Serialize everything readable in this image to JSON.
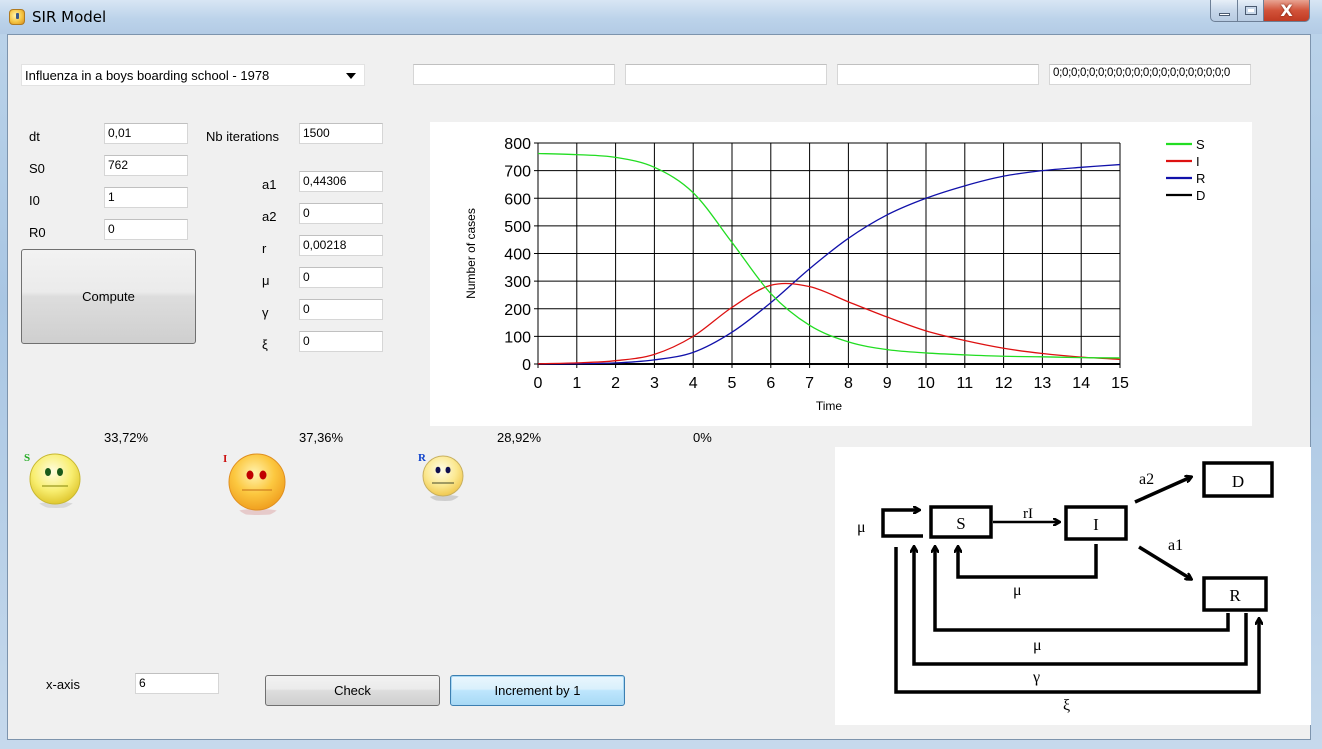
{
  "window": {
    "title": "SIR Model",
    "app_icon": "sir-app-icon",
    "controls": {
      "minimize": "minimize-icon",
      "maximize": "maximize-icon",
      "close": "close-icon"
    },
    "close_glyph": "X"
  },
  "top_row": {
    "scenario_select": {
      "value": "Influenza in a boys boarding school - 1978",
      "icon": "chevron-down-icon"
    },
    "text_boxes": [
      "",
      "",
      "",
      "0;0;0;0;0;0;0;0;0;0;0;0;0;0;0;0;0;0;0;0"
    ]
  },
  "params_left": [
    {
      "label": "dt",
      "value": "0,01"
    },
    {
      "label": "S0",
      "value": "762"
    },
    {
      "label": "I0",
      "value": "1"
    },
    {
      "label": "R0",
      "value": "0"
    }
  ],
  "iterations": {
    "label": "Nb iterations",
    "value": "1500"
  },
  "params_right": [
    {
      "label": "a1",
      "value": "0,44306"
    },
    {
      "label": "a2",
      "value": "0"
    },
    {
      "label": "r",
      "value": "0,00218"
    },
    {
      "label": "μ",
      "value": "0"
    },
    {
      "label": "γ",
      "value": "0"
    },
    {
      "label": "ξ",
      "value": "0"
    }
  ],
  "compute_button": "Compute",
  "percentages": {
    "S": "33,72%",
    "I": "37,36%",
    "R": "28,92%",
    "D": "0%"
  },
  "smileys": [
    {
      "letter": "S",
      "icon": "neutral-smiley-icon",
      "letter_color": "#22aa22",
      "eye_color": "#1a5a1a"
    },
    {
      "letter": "I",
      "icon": "neutral-smiley-icon",
      "letter_color": "#cc1111",
      "eye_color": "#c00000"
    },
    {
      "letter": "R",
      "icon": "neutral-smiley-icon",
      "letter_color": "#1144cc",
      "eye_color": "#101050"
    }
  ],
  "x_axis": {
    "label": "x-axis",
    "value": "6"
  },
  "check_button": "Check",
  "increment_button": "Increment by 1",
  "diagram": {
    "nodes": [
      "S",
      "I",
      "D",
      "R"
    ],
    "edge_labels": {
      "birth": "μ",
      "infection": "rI",
      "death": "a2",
      "recovery": "a1",
      "i_to_s": "μ",
      "r_to_s": "μ",
      "gamma": "γ",
      "xi": "ξ"
    }
  },
  "chart_data": {
    "type": "line",
    "title": "",
    "xlabel": "Time",
    "ylabel": "Number of cases",
    "xlim": [
      0,
      15
    ],
    "ylim": [
      0,
      800
    ],
    "x_ticks": [
      "0",
      "1",
      "2",
      "3",
      "4",
      "5",
      "6",
      "7",
      "8",
      "9",
      "10",
      "11",
      "12",
      "13",
      "14",
      "15"
    ],
    "y_ticks": [
      "0",
      "100",
      "200",
      "300",
      "400",
      "500",
      "600",
      "700",
      "800"
    ],
    "grid": true,
    "legend": "top-right",
    "x": [
      0,
      1,
      2,
      3,
      4,
      5,
      6,
      7,
      8,
      9,
      10,
      11,
      12,
      13,
      14,
      15
    ],
    "series": [
      {
        "name": "S",
        "color": "#22dd22",
        "values": [
          762,
          758,
          748,
          712,
          620,
          440,
          255,
          140,
          80,
          52,
          40,
          33,
          28,
          26,
          23,
          22
        ]
      },
      {
        "name": "I",
        "color": "#dd1111",
        "values": [
          1,
          4,
          12,
          35,
          100,
          205,
          285,
          280,
          225,
          170,
          120,
          85,
          57,
          38,
          25,
          17
        ]
      },
      {
        "name": "R",
        "color": "#1111aa",
        "values": [
          0,
          1,
          4,
          15,
          42,
          115,
          222,
          345,
          455,
          540,
          600,
          645,
          680,
          700,
          712,
          722
        ]
      },
      {
        "name": "D",
        "color": "#000000",
        "values": [
          0,
          0,
          0,
          0,
          0,
          0,
          0,
          0,
          0,
          0,
          0,
          0,
          0,
          0,
          0,
          0
        ]
      }
    ]
  }
}
